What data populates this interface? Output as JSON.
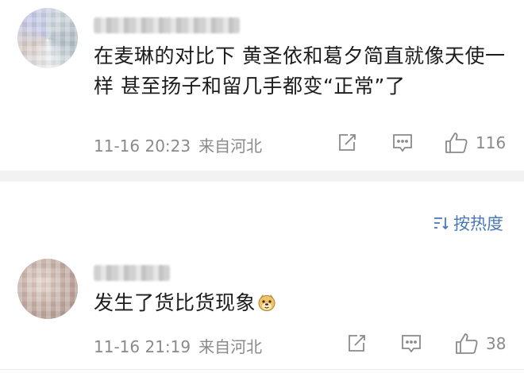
{
  "comments": [
    {
      "text": "在麦琳的对比下 黄圣依和葛夕简直就像天使一样 甚至扬子和留几手都变“正常”了",
      "timestamp": "11-16 20:23",
      "location": "来自河北",
      "like_count": "116"
    },
    {
      "text": "发生了货比货现象",
      "emoji": "doge-emoji",
      "timestamp": "11-16 21:19",
      "location": "来自河北",
      "like_count": "38"
    }
  ],
  "sort": {
    "label": "按热度",
    "icon": "sort-icon"
  },
  "icons": {
    "share": "share-icon",
    "comment": "comment-icon",
    "like": "thumbs-up-icon"
  },
  "colors": {
    "meta_text": "#8a8a8a",
    "sort_accent": "#4a79b5",
    "divider": "#f2f2f2"
  }
}
